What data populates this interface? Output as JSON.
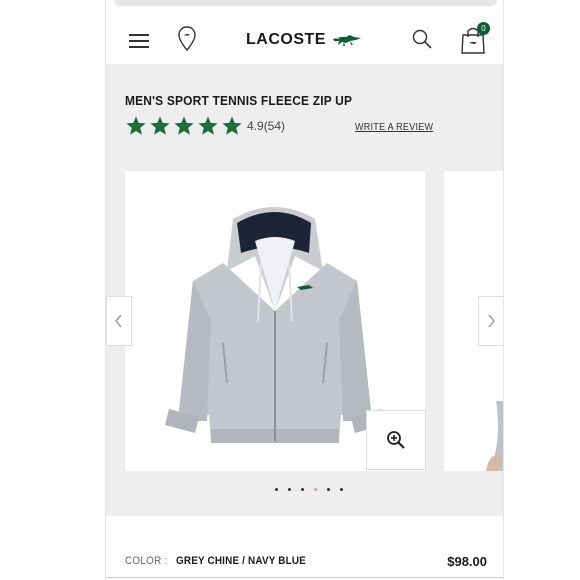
{
  "brand": {
    "name": "LACOSTE",
    "accent": "#0b5e2f"
  },
  "header": {
    "menu_icon": "hamburger-icon",
    "store_icon": "location-pin-icon",
    "search_icon": "search-icon",
    "cart_icon": "shopping-bag-icon",
    "cart_count": "0"
  },
  "product": {
    "title": "MEN'S SPORT TENNIS FLEECE ZIP UP",
    "rating_value": "4.9",
    "rating_count": "(54)",
    "rating_stars": 5,
    "review_link": "WRITE A REVIEW",
    "color_label": "COLOR :",
    "color_value": "GREY CHINE / NAVY BLUE",
    "price": "$98.00"
  },
  "carousel": {
    "slide_count": 6,
    "active_index": 3,
    "zoom_icon": "zoom-in-icon",
    "prev_icon": "chevron-left-icon",
    "next_icon": "chevron-right-icon"
  }
}
